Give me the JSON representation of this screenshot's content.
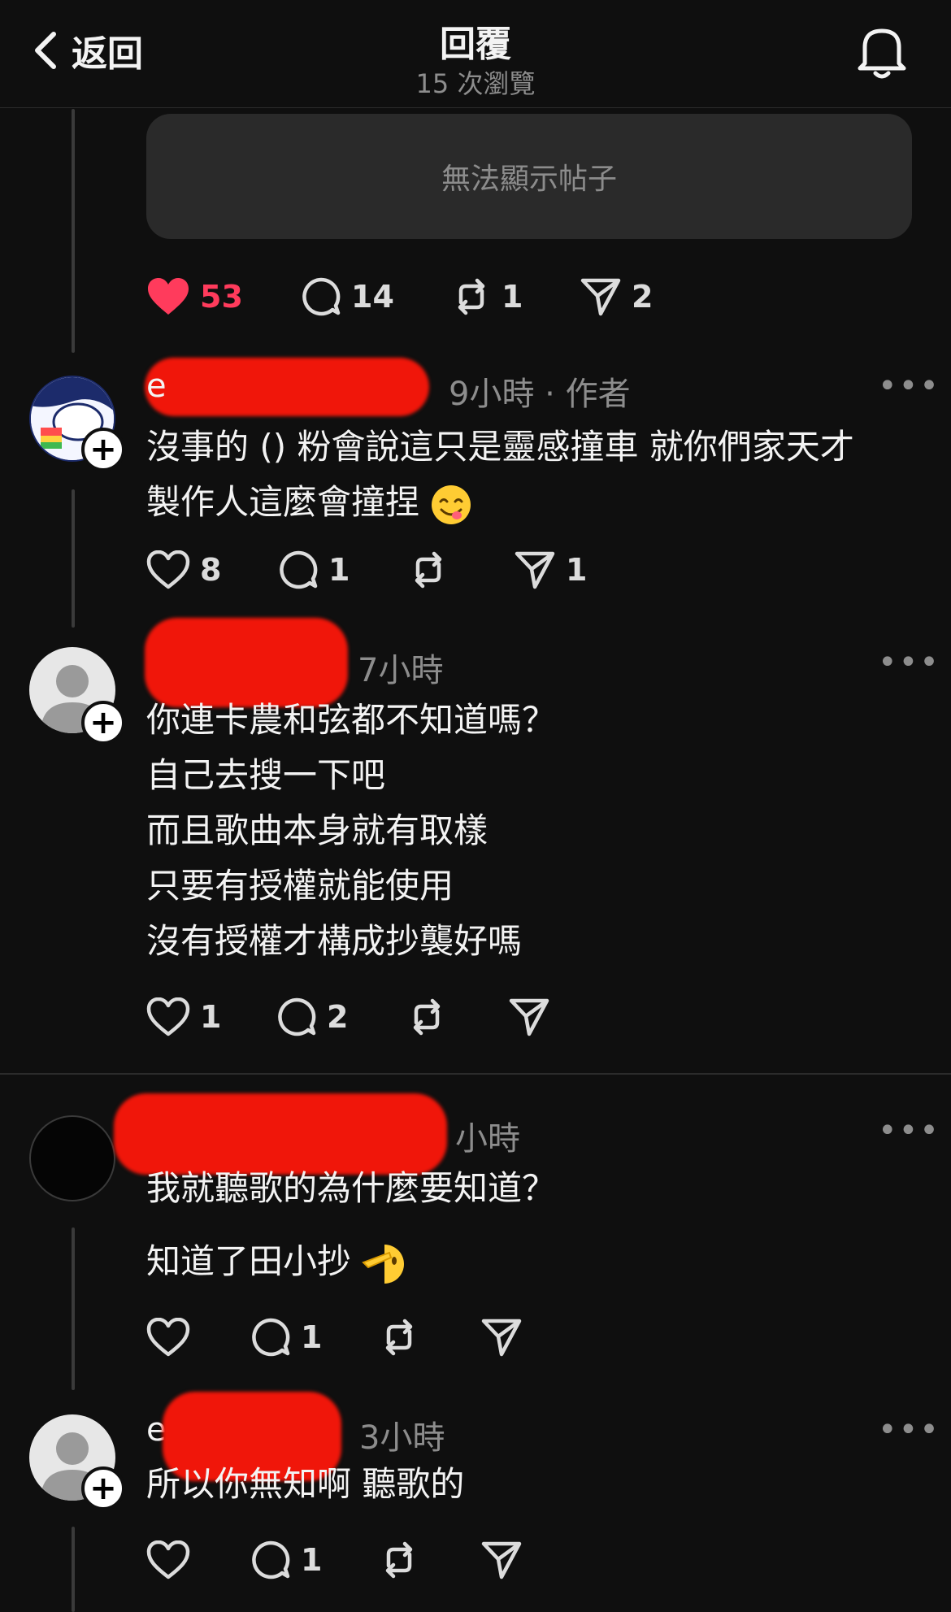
{
  "header": {
    "back_label": "返回",
    "title": "回覆",
    "subtitle": "15 次瀏覽"
  },
  "quoted_post": {
    "unavailable_text": "無法顯示帖子"
  },
  "root_actions": {
    "likes": "53",
    "comments": "14",
    "reposts": "1",
    "shares": "2"
  },
  "replies": [
    {
      "username_visible": "e",
      "time": "9小時",
      "author_tag": "作者",
      "lines": [
        "沒事的 () 粉會說這只是靈感撞車 就你們家天才",
        "製作人這麼會撞捏"
      ],
      "emoji": "yum-face",
      "likes": "8",
      "comments": "1",
      "reposts": "",
      "shares": "1"
    },
    {
      "username_visible": "",
      "time": "7小時",
      "lines": [
        "你連卡農和弦都不知道嗎？",
        "自己去搜一下吧",
        "而且歌曲本身就有取樣",
        "只要有授權就能使用",
        "沒有授權才構成抄襲好嗎"
      ],
      "likes": "1",
      "comments": "2",
      "reposts": "",
      "shares": ""
    },
    {
      "username_visible": "",
      "time": "小時",
      "lines": [
        "我就聽歌的為什麼要知道？",
        "知道了田小抄"
      ],
      "emoji": "saluting-face",
      "likes": "",
      "comments": "1",
      "reposts": "",
      "shares": ""
    },
    {
      "username_visible": "e",
      "time": "3小時",
      "lines": [
        "所以你無知啊 聽歌的"
      ],
      "likes": "",
      "comments": "1",
      "reposts": "",
      "shares": ""
    }
  ],
  "more_label": "•••",
  "colors": {
    "background": "#0f0f0f",
    "like_red": "#ff3b5c",
    "card": "#2a2a2a",
    "muted": "#8d8d8d",
    "redaction": "#f0160a"
  }
}
